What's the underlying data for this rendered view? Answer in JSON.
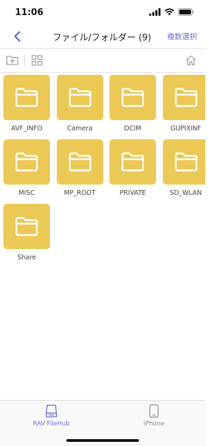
{
  "status_bar": {
    "time": "11:06"
  },
  "nav": {
    "back_icon": "chevron-left-icon",
    "title": "ファイル/フォルダー (9)",
    "action_label": "複数選択"
  },
  "toolbar": {
    "new_folder_icon": "folder-plus-icon",
    "grid_view_icon": "grid-view-icon",
    "home_icon": "home-icon"
  },
  "folders": [
    {
      "name": "AVF_INFO"
    },
    {
      "name": "Camera"
    },
    {
      "name": "DCIM"
    },
    {
      "name": "GUPIXINF"
    },
    {
      "name": "MISC"
    },
    {
      "name": "MP_ROOT"
    },
    {
      "name": "PRIVATE"
    },
    {
      "name": "SD_WLAN"
    },
    {
      "name": "Share"
    }
  ],
  "tabs": [
    {
      "label": "RAV FileHub",
      "icon": "storage-drive-icon",
      "active": true
    },
    {
      "label": "iPhone",
      "icon": "phone-icon",
      "active": false
    }
  ],
  "colors": {
    "accent": "#6c6fd8",
    "folder": "#ecc955",
    "inactive_tab": "#8a8a8e"
  }
}
